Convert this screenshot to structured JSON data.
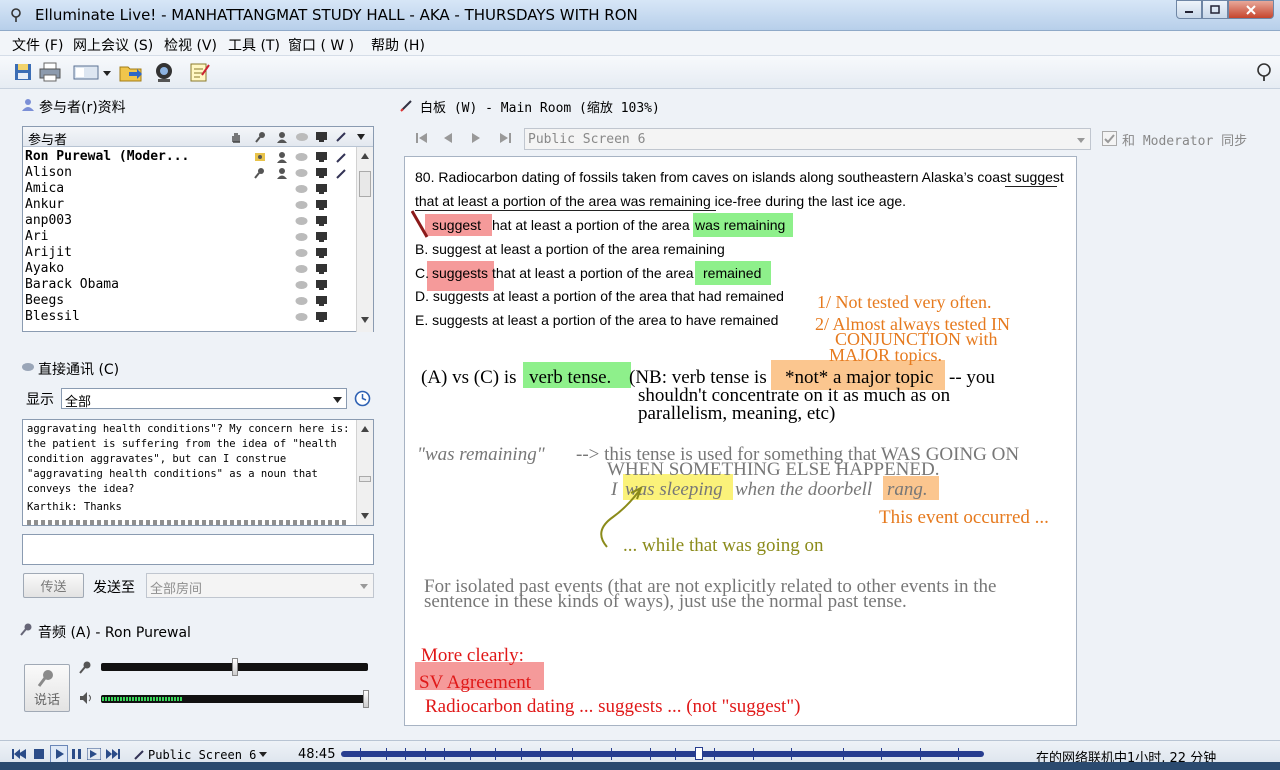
{
  "window": {
    "title": "Elluminate Live! - MANHATTANGMAT STUDY HALL - AKA - THURSDAYS WITH RON"
  },
  "menu": [
    "文件 (F)",
    "网上会议 (S)",
    "检视 (V)",
    "工具 (T)",
    "窗口 ( W )",
    "帮助 (H)"
  ],
  "participants": {
    "title": "参与者(r)资料",
    "header": "参与者",
    "rows": [
      "Ron Purewal (Moder...",
      "Alison",
      "Amica",
      "Ankur",
      "anp003",
      "Ari",
      "Arijit",
      "Ayako",
      "Barack Obama",
      "Beegs",
      "Blessil"
    ]
  },
  "chat": {
    "title": "直接通讯 (C)",
    "show_label": "显示",
    "filter": "全部",
    "messages": "aggravating health conditions\"? My concern here is:\nthe patient is suffering from the idea of \"health\ncondition aggravates\", but can I construe\n\"aggravating health conditions\" as a noun that\nconveys the idea?",
    "reply": "Karthik: Thanks",
    "send_button": "传送",
    "send_to_label": "发送至",
    "send_to_value": "全部房间"
  },
  "audio": {
    "title": "音频 (A) - Ron Purewal",
    "talk_button": "说话",
    "mic_level": 0.5,
    "speaker_level": 0.3
  },
  "whiteboard": {
    "title": "白板 (W) - Main Room (缩放 103%)",
    "screen_select": "Public Screen 6",
    "sync_label": "和 Moderator 同步",
    "q_line1": "80. Radiocarbon dating of fossils taken from caves on islands along southeastern Alaska’s coast suggest",
    "q_line2": "that at least a portion of the area was remaining ice-free during the last ice age.",
    "optA_1": "suggest",
    "optA_2": "hat at least a portion of the area",
    "optA_3": "was remaining",
    "optB": "B. suggest at least a portion of the area remaining",
    "optC_0": "C.",
    "optC_1": "suggests",
    "optC_2": "that at least a portion of the area",
    "optC_3": "remained",
    "optD": "D. suggests at least a portion of the area that had remained",
    "optE": "E. suggests at least a portion of the area to have remained",
    "note1": "1/ Not tested very often.",
    "note2a": "2/ Almost always tested IN",
    "note2b": "CONJUNCTION with",
    "note2c": "MAJOR topics.",
    "avc_1": "(A) vs (C) is",
    "avc_2": "verb tense.",
    "avc_3": "(NB: verb tense is",
    "avc_4": "*not* a major topic",
    "avc_5": "-- you",
    "avc_6": "shouldn't concentrate on it as much as on",
    "avc_7": "parallelism, meaning, etc)",
    "wr_1": "\"was remaining\"",
    "wr_2": "--> this tense is used for something that WAS GOING ON",
    "wr_3": "WHEN SOMETHING ELSE HAPPENED.",
    "ex_1": "I",
    "ex_2": "was sleeping",
    "ex_3": "when the doorbell",
    "ex_4": "rang.",
    "event": "This event occurred ...",
    "while": "... while that was going on",
    "iso_1": "For isolated past events (that are not explicitly related to other events in the",
    "iso_2": "sentence in these kinds of ways), just use the normal past tense.",
    "more": "More clearly:",
    "sv": "SV Agreement",
    "radio": "Radiocarbon dating ... suggests ... (not \"suggest\")"
  },
  "status": {
    "screen": "Public Screen 6",
    "time": "48:45",
    "progress": 0.55,
    "online": "在的网络联机中1小时, 22 分钟"
  }
}
